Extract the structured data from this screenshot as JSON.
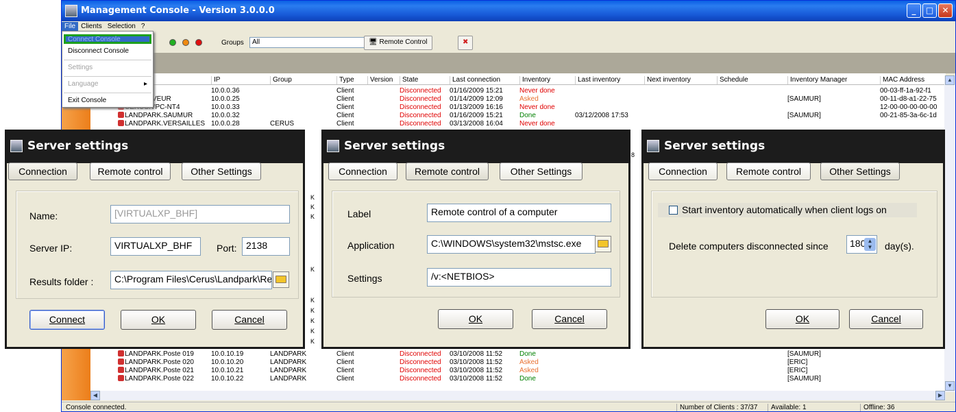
{
  "main": {
    "title": "Management Console - Version 3.0.0.0",
    "menu": [
      "File",
      "Clients",
      "Selection",
      "?"
    ],
    "toolbar": {
      "groups_label": "Groups",
      "groups_value": "All",
      "remote_control": "Remote Control",
      "status_dots": [
        "#22b022",
        "#f08a10",
        "#e01010"
      ]
    },
    "columns": [
      "IP",
      "Group",
      "Type",
      "Version",
      "State",
      "Last connection",
      "Inventory",
      "Last inventory",
      "Next inventory",
      "Schedule",
      "Inventory Manager",
      "MAC Address"
    ],
    "rows_top": [
      {
        "name": "",
        "ip": "10.0.0.36",
        "group": "",
        "type": "Client",
        "state": "Disconnected",
        "last": "01/16/2009 15:21",
        "inv": "Never done",
        "invc": "red",
        "lastinv": "",
        "mgr": "",
        "mac": "00-03-ff-1a-92-f1"
      },
      {
        "name": "VEUR",
        "ip": "10.0.0.25",
        "group": "",
        "type": "Client",
        "state": "Disconnected",
        "last": "01/14/2009 12:09",
        "inv": "Asked",
        "invc": "org",
        "lastinv": "",
        "mgr": "[SAUMUR]",
        "mac": "00-11-d8-a1-22-75"
      },
      {
        "name": "CERUS.VPC-NT4",
        "ip": "10.0.0.33",
        "group": "",
        "type": "Client",
        "state": "Disconnected",
        "last": "01/13/2009 16:16",
        "inv": "Never done",
        "invc": "red",
        "lastinv": "",
        "mgr": "",
        "mac": "12-00-00-00-00-00"
      },
      {
        "name": "LANDPARK.SAUMUR",
        "ip": "10.0.0.32",
        "group": "",
        "type": "Client",
        "state": "Disconnected",
        "last": "01/16/2009 15:21",
        "inv": "Done",
        "invc": "grn",
        "lastinv": "03/12/2008 17:53",
        "mgr": "[SAUMUR]",
        "mac": "00-21-85-3a-6c-1d"
      },
      {
        "name": "LANDPARK.VERSAILLES",
        "ip": "10.0.0.28",
        "group": "CERUS",
        "type": "Client",
        "state": "Disconnected",
        "last": "03/13/2008 16:04",
        "inv": "Never done",
        "invc": "red",
        "lastinv": "",
        "mgr": "",
        "mac": ""
      }
    ],
    "rows_bottom": [
      {
        "name": "LANDPARK.Poste 019",
        "ip": "10.0.10.19",
        "group": "LANDPARK",
        "type": "Client",
        "state": "Disconnected",
        "last": "03/10/2008 11:52",
        "inv": "Done",
        "invc": "grn",
        "mgr": "[SAUMUR]"
      },
      {
        "name": "LANDPARK.Poste 020",
        "ip": "10.0.10.20",
        "group": "LANDPARK",
        "type": "Client",
        "state": "Disconnected",
        "last": "03/10/2008 11:52",
        "inv": "Asked",
        "invc": "org",
        "mgr": "[ERIC]"
      },
      {
        "name": "LANDPARK.Poste 021",
        "ip": "10.0.10.21",
        "group": "LANDPARK",
        "type": "Client",
        "state": "Disconnected",
        "last": "03/10/2008 11:52",
        "inv": "Asked",
        "invc": "org",
        "mgr": "[ERIC]"
      },
      {
        "name": "LANDPARK.Poste 022",
        "ip": "10.0.10.22",
        "group": "LANDPARK",
        "type": "Client",
        "state": "Disconnected",
        "last": "03/10/2008 11:52",
        "inv": "Done",
        "invc": "grn",
        "mgr": "[SAUMUR]"
      }
    ],
    "status": {
      "text": "Console connected.",
      "clients": "Number of Clients : 37/37",
      "available": "Available: 1",
      "offline": "Offline: 36"
    }
  },
  "file_menu": {
    "connect": "Connect Console",
    "disconnect": "Disconnect Console",
    "settings": "Settings",
    "language": "Language",
    "exit": "Exit Console"
  },
  "dialog": {
    "title": "Server settings",
    "tabs": [
      "Connection",
      "Remote control",
      "Other Settings"
    ],
    "ok": "OK",
    "cancel": "Cancel",
    "connect": "Connect"
  },
  "conn": {
    "name_label": "Name:",
    "name_value": "[VIRTUALXP_BHF]",
    "ip_label": "Server IP:",
    "ip_value": "VIRTUALXP_BHF",
    "port_label": "Port:",
    "port_value": "2138",
    "folder_label": "Results folder :",
    "folder_value": "C:\\Program Files\\Cerus\\Landpark\\Re"
  },
  "remote": {
    "label_label": "Label",
    "label_value": "Remote control of a computer",
    "app_label": "Application",
    "app_value": "C:\\WINDOWS\\system32\\mstsc.exe",
    "settings_label": "Settings",
    "settings_value": "/v:<NETBIOS>"
  },
  "other": {
    "auto_inv": "Start inventory automatically when client logs on",
    "auto_inv_checked": false,
    "delete_label": "Delete computers disconnected since",
    "days": "180",
    "days_unit": "day(s)."
  },
  "stray": {
    "k1": "K",
    "k2": "K",
    "k3": "K",
    "k4": "K",
    "k5": "K",
    "k6": "K",
    "k7": "K",
    "k8": "K",
    "k9": "K",
    "eight": "8"
  }
}
